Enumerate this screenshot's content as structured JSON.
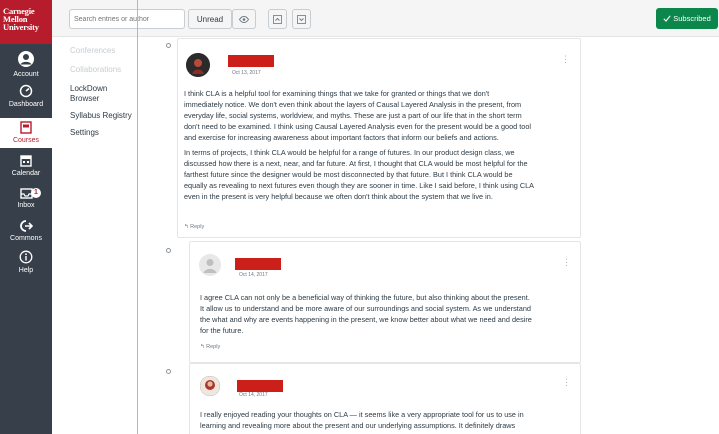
{
  "global_nav": {
    "logo_lines": [
      "Carnegie",
      "Mellon",
      "University"
    ],
    "items": [
      {
        "label": "Account",
        "icon": "account-icon"
      },
      {
        "label": "Dashboard",
        "icon": "dashboard-icon"
      },
      {
        "label": "Courses",
        "icon": "courses-icon"
      },
      {
        "label": "Calendar",
        "icon": "calendar-icon"
      },
      {
        "label": "Inbox",
        "icon": "inbox-icon",
        "badge": "1"
      },
      {
        "label": "Commons",
        "icon": "commons-icon"
      },
      {
        "label": "Help",
        "icon": "help-icon"
      }
    ]
  },
  "course_nav": {
    "items": [
      "Conferences",
      "Collaborations",
      "LockDown",
      "Browser",
      "Syllabus Registry",
      "Settings"
    ]
  },
  "toolbar": {
    "search_placeholder": "Search entries or author",
    "unread_label": "Unread",
    "subscribed_label": "Subscribed"
  },
  "posts": [
    {
      "date": "Oct 13, 2017",
      "paragraphs": [
        "I think CLA is a helpful tool for examining things that we take for granted or things that we don't",
        "immediately notice. We don't even think about the layers of Causal Layered Analysis in the present, from",
        "everyday life, social systems, worldview, and myths. These are just a part of our life that in the short term",
        "don't need to be examined. I think using Causal Layered Analysis even for the present would be a good tool",
        "and exercise for increasing awareness about important factors that inform our beliefs and actions.",
        "In terms of projects, I think CLA would be helpful for a range of futures. In our product design class, we",
        "discussed how there is a next, near, and far future. At first, I thought that CLA would be most helpful for the",
        "farthest future since the designer would be most disconnected by that future. But I think CLA would be",
        "equally as revealing to next futures even though they are sooner in time. Like I said before, I think using CLA",
        "even in the present is very helpful because we often don't think about the system that we live in."
      ],
      "reply_label": "Reply"
    },
    {
      "date": "Oct 14, 2017",
      "paragraphs": [
        "I agree CLA can not only be a beneficial way of thinking the future, but also thinking about the present.",
        "It allow us to understand and be more aware of our surroundings and social system. As we understand",
        "the what and why are events happening in the present, we know better about what we need and desire",
        "for the future."
      ],
      "reply_label": "Reply"
    },
    {
      "date": "Oct 14, 2017",
      "paragraphs": [
        "I really enjoyed reading your thoughts on CLA — it seems like a very appropriate tool for us to use in",
        "learning and revealing more about the present and our underlying assumptions. It definitely draws"
      ]
    }
  ],
  "colors": {
    "nav_bg": "#373f4a",
    "brand_red": "#b71c2c",
    "subscribed_green": "#0b874b",
    "redaction": "#cc1f1a",
    "divider": "#e8b252"
  }
}
